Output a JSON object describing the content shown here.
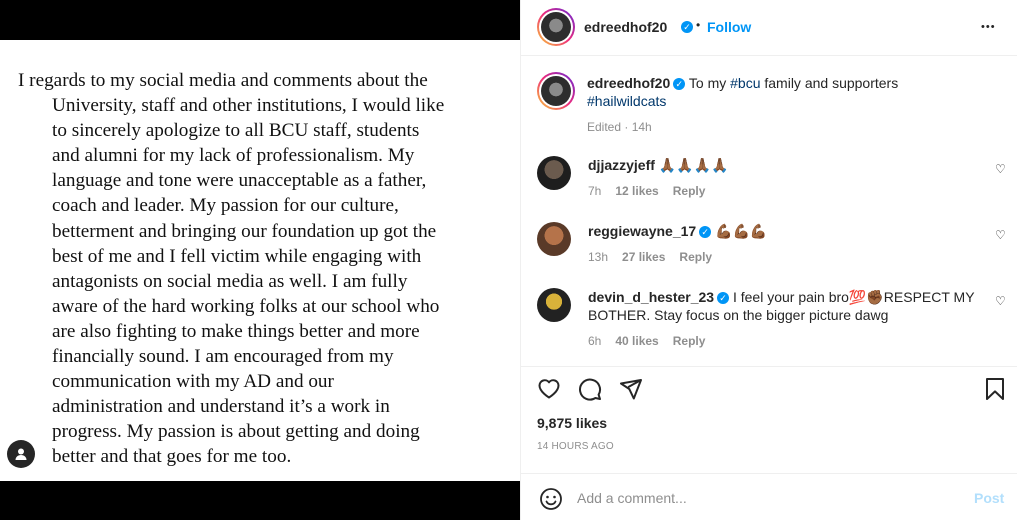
{
  "media": {
    "letter_lines": [
      "I regards to my social media and comments about the",
      "University, staff and other institutions, I would like",
      "to sincerely apologize to all BCU staff, students",
      "and alumni for my lack of professionalism. My",
      "language and tone were unacceptable as a father,",
      "coach and leader. My passion for our culture,",
      "betterment and bringing our foundation up got the",
      "best of me and I fell victim while engaging with",
      "antagonists on social media as well.    I am fully",
      "aware of the hard working folks at our school who",
      "are also fighting to make things better and more",
      "financially sound.  I am encouraged from my",
      "communication with my AD and our",
      "administration and understand it’s a work in",
      "progress. My passion is about getting and doing",
      "better and that goes for me too."
    ]
  },
  "header": {
    "username": "edreedhof20",
    "dot": "•",
    "follow_label": "Follow",
    "more_label": "•••"
  },
  "caption": {
    "username": "edreedhof20",
    "text_a": "To my ",
    "mention": "#bcu",
    "text_b": " family and supporters",
    "hashtag": "#hailwildcats",
    "meta": "Edited · 14h"
  },
  "comments": [
    {
      "username": "djjazzyjeff",
      "text": "🙏🏾🙏🏾🙏🏾🙏🏾",
      "time": "7h",
      "likes": "12 likes",
      "reply": "Reply"
    },
    {
      "username": "reggiewayne_17",
      "text": "💪🏾💪🏾💪🏾",
      "time": "13h",
      "likes": "27 likes",
      "reply": "Reply"
    },
    {
      "username": "devin_d_hester_23",
      "text_a": "I feel your pain bro💯✊🏾RESPECT MY",
      "text_b": "BOTHER. Stay focus on the bigger picture dawg",
      "time": "6h",
      "likes": "40 likes",
      "reply": "Reply"
    }
  ],
  "likes": "9,875 likes",
  "timestamp": "14 HOURS AGO",
  "add_comment": {
    "placeholder": "Add a comment...",
    "post_label": "Post"
  },
  "icons": {
    "verified": "✓",
    "heart_small": "♡"
  }
}
